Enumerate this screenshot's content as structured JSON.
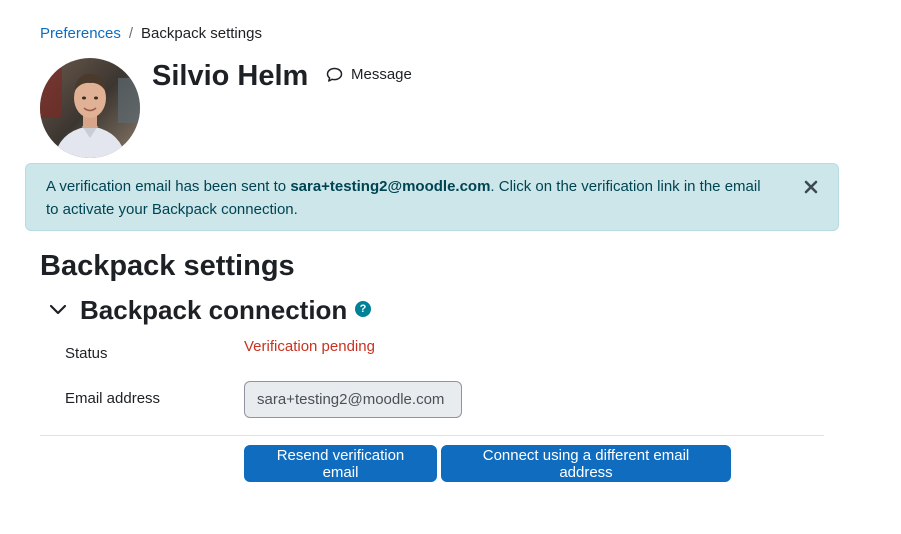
{
  "breadcrumb": {
    "items": [
      {
        "label": "Preferences"
      },
      {
        "label": "Backpack settings"
      }
    ],
    "separator": "/"
  },
  "profile": {
    "name": "Silvio Helm",
    "message_label": "Message",
    "avatar_icon": "user-photo"
  },
  "alert": {
    "text_before": "A verification email has been sent to ",
    "email": "sara+testing2@moodle.com",
    "text_after": ". Click on the verification link in the email to activate your Backpack connection.",
    "close_icon": "close-icon",
    "color_bg": "#cce6ea",
    "color_text": "#004452"
  },
  "page": {
    "title": "Backpack settings",
    "section_title": "Backpack connection",
    "help_icon": "?"
  },
  "form": {
    "status_label": "Status",
    "status_value": "Verification pending",
    "status_color": "#ca3120",
    "email_label": "Email address",
    "email_value": "sara+testing2@moodle.com"
  },
  "actions": {
    "resend_label": "Resend verification email",
    "connect_label": "Connect using a different email address",
    "primary_color": "#0f6cbf"
  }
}
